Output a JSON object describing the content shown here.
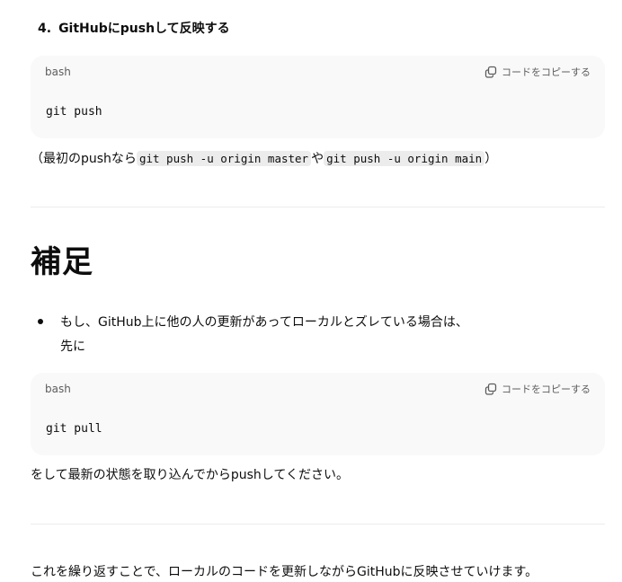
{
  "step": {
    "number": "4.",
    "title": "GitHubにpushして反映する"
  },
  "code_blocks": [
    {
      "lang": "bash",
      "copy_label": "コードをコピーする",
      "copy_icon": "copy-icon",
      "code": "git push"
    },
    {
      "lang": "bash",
      "copy_label": "コードをコピーする",
      "copy_icon": "copy-icon",
      "code": "git pull"
    }
  ],
  "first_push_note": {
    "open": "（最初のpushなら",
    "code1": "git push -u origin master",
    "mid": "や",
    "code2": "git push -u origin main",
    "close": "）"
  },
  "supplement": {
    "heading": "補足",
    "bullet_line1": "もし、GitHub上に他の人の更新があってローカルとズレている場合は、",
    "bullet_line2": "先に",
    "after_code": "をして最新の状態を取り込んでからpushしてください。"
  },
  "closing": "これを繰り返すことで、ローカルのコードを更新しながらGitHubに反映させていけます。"
}
